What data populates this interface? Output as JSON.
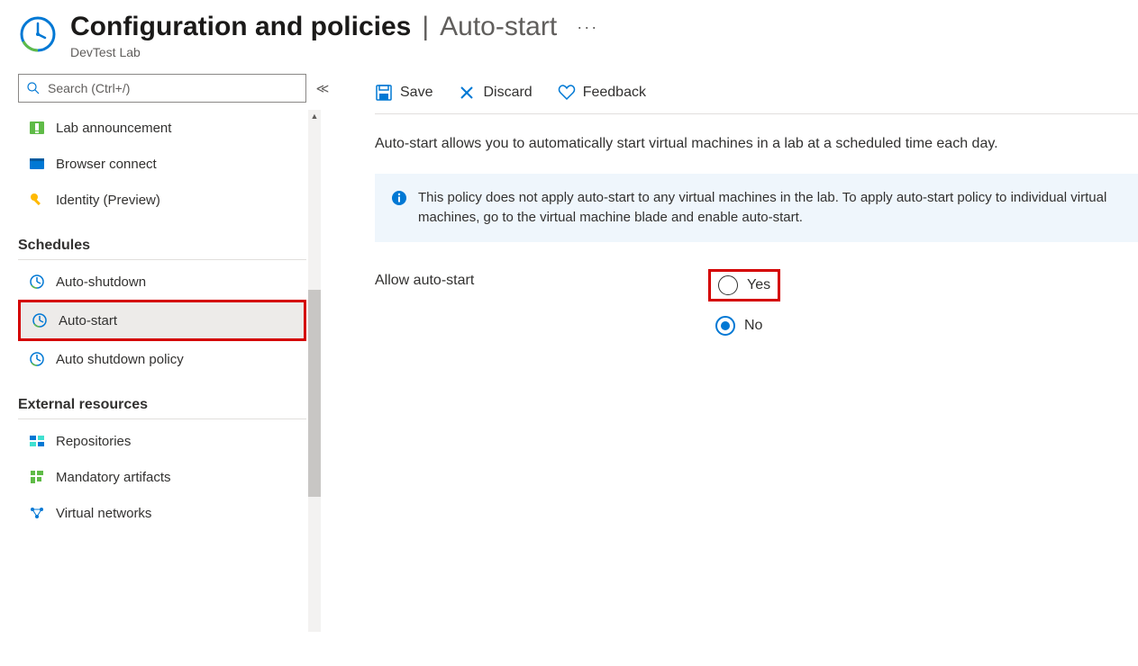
{
  "header": {
    "title": "Configuration and policies",
    "subtitle": "Auto-start",
    "breadcrumb": "DevTest Lab"
  },
  "search": {
    "placeholder": "Search (Ctrl+/)"
  },
  "sidebar": {
    "ungrouped": [
      {
        "label": "Lab announcement"
      },
      {
        "label": "Browser connect"
      },
      {
        "label": "Identity (Preview)"
      }
    ],
    "sections": [
      {
        "label": "Schedules",
        "items": [
          {
            "label": "Auto-shutdown"
          },
          {
            "label": "Auto-start"
          },
          {
            "label": "Auto shutdown policy"
          }
        ]
      },
      {
        "label": "External resources",
        "items": [
          {
            "label": "Repositories"
          },
          {
            "label": "Mandatory artifacts"
          },
          {
            "label": "Virtual networks"
          }
        ]
      }
    ]
  },
  "toolbar": {
    "save_label": "Save",
    "discard_label": "Discard",
    "feedback_label": "Feedback"
  },
  "main": {
    "description": "Auto-start allows you to automatically start virtual machines in a lab at a scheduled time each day.",
    "info_text": "This policy does not apply auto-start to any virtual machines in the lab. To apply auto-start policy to individual virtual machines, go to the virtual machine blade and enable auto-start.",
    "allow_label": "Allow auto-start",
    "option_yes": "Yes",
    "option_no": "No"
  }
}
